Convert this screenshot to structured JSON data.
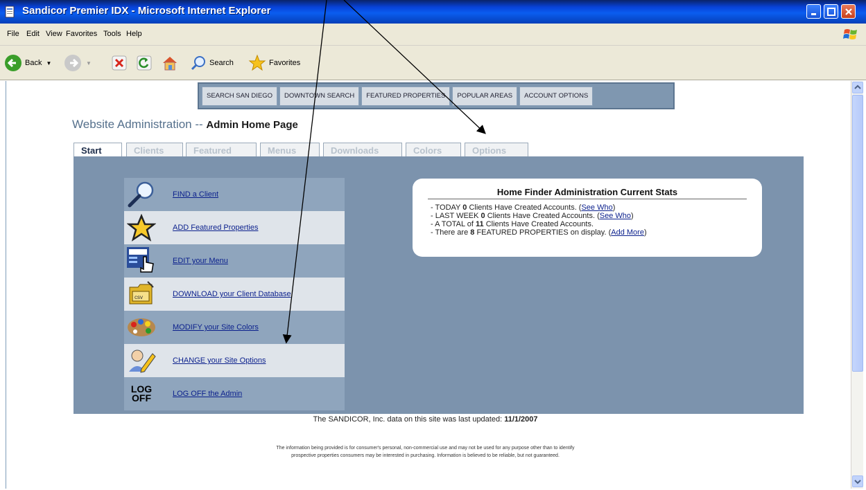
{
  "window": {
    "title": "Sandicor Premier IDX - Microsoft Internet Explorer"
  },
  "menubar": [
    "File",
    "Edit",
    "View",
    "Favorites",
    "Tools",
    "Help"
  ],
  "toolbar": {
    "back": "Back",
    "search": "Search",
    "favorites": "Favorites"
  },
  "sitenav": [
    "SEARCH SAN DIEGO",
    "DOWNTOWN SEARCH",
    "FEATURED PROPERTIES",
    "POPULAR AREAS",
    "ACCOUNT OPTIONS"
  ],
  "heading": {
    "section": "Website Administration -- ",
    "page": "Admin Home Page"
  },
  "tabs": [
    "Start",
    "Clients",
    "Featured",
    "Menus",
    "Downloads",
    "Colors",
    "Options"
  ],
  "admin_menu": [
    {
      "label": "FIND a Client",
      "icon": "magnifier-icon"
    },
    {
      "label": "ADD Featured Properties",
      "icon": "star-icon"
    },
    {
      "label": "EDIT your Menu",
      "icon": "menu-hand-icon"
    },
    {
      "label": "DOWNLOAD your Client Database",
      "icon": "csv-folder-icon"
    },
    {
      "label": "MODIFY your Site Colors",
      "icon": "paint-palette-icon"
    },
    {
      "label": "CHANGE your Site Options",
      "icon": "user-pencil-icon"
    },
    {
      "label": "LOG OFF the Admin",
      "icon": "log-off-icon",
      "icon_text": [
        "LOG",
        "OFF"
      ]
    }
  ],
  "stats": {
    "title": "Home Finder Administration Current Stats",
    "today": {
      "pre": "- TODAY ",
      "count": "0",
      "post": " Clients Have Created Accounts. (",
      "link": "See Who",
      "end": ")"
    },
    "week": {
      "pre": "- LAST WEEK ",
      "count": "0",
      "post": " Clients Have Created Accounts. (",
      "link": "See Who",
      "end": ")"
    },
    "total": {
      "pre": "- A TOTAL of ",
      "count": "11",
      "post": " Clients Have Created Accounts."
    },
    "featured": {
      "pre": "- There are ",
      "count": "8",
      "post": " FEATURED PROPERTIES on display. (",
      "link": "Add More",
      "end": ")"
    }
  },
  "footer": {
    "updated_pre": "The SANDICOR, Inc. data on this site was last updated: ",
    "updated_date": "11/1/2007",
    "disclaimer_1": "The information being provided is for consumer's personal, non-commercial use and may not be used for any purpose other than to identify",
    "disclaimer_2": "prospective properties consumers may be interested in purchasing. Information is believed to be reliable, but not guaranteed."
  },
  "colors": {
    "titlebar": "#0842d8",
    "panel": "#7c93ad",
    "link": "#0a1f8c",
    "heading": "#55708c"
  }
}
